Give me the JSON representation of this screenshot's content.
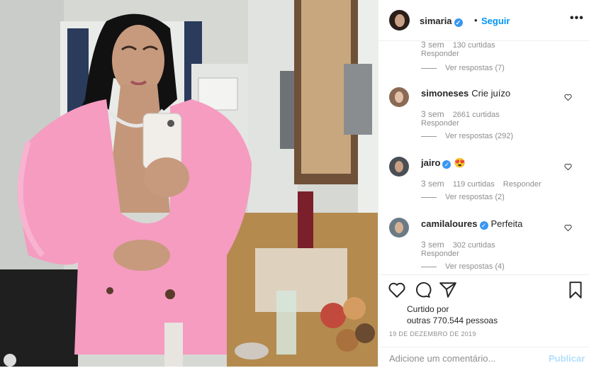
{
  "post": {
    "username": "simaria",
    "follow_label": "Seguir",
    "separator": "•",
    "more_label": "•••",
    "verified_glyph": "✓"
  },
  "comments": [
    {
      "username": "",
      "text": "",
      "time": "3 sem",
      "likes": "130 curtidas",
      "reply": "Responder",
      "view_replies": "Ver respostas (7)"
    },
    {
      "username": "simoneses",
      "verified": false,
      "text": "Crie juízo",
      "time": "3 sem",
      "likes": "2661 curtidas",
      "reply": "Responder",
      "view_replies": "Ver respostas (292)"
    },
    {
      "username": "jairo",
      "verified": true,
      "text": "😍",
      "time": "3 sem",
      "likes": "119 curtidas",
      "reply": "Responder",
      "view_replies": "Ver respostas (2)"
    },
    {
      "username": "camilaloures",
      "verified": true,
      "text": "Perfeita",
      "time": "3 sem",
      "likes": "302 curtidas",
      "reply": "Responder",
      "view_replies": "Ver respostas (4)"
    }
  ],
  "likes": {
    "line1": "Curtido por",
    "line2": "outras 770.544 pessoas"
  },
  "date": "19 DE DEZEMBRO DE 2019",
  "add_comment": {
    "placeholder": "Adicione um comentário...",
    "publish_label": "Publicar"
  },
  "icons": {
    "header_more": "more-options-icon",
    "like": "heart-icon",
    "comment": "comment-bubble-icon",
    "share": "paper-plane-icon",
    "save": "bookmark-icon",
    "comment_like": "small-heart-icon"
  },
  "colors": {
    "accent": "#0095f6",
    "verified": "#3897f0",
    "coat": "#f59cc0",
    "muted": "#8e8e8e"
  }
}
